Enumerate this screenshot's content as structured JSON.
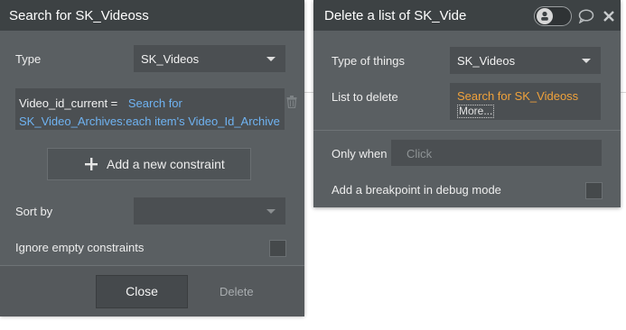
{
  "search_panel": {
    "title": "Search for SK_Videoss",
    "type_label": "Type",
    "type_value": "SK_Videos",
    "constraint": {
      "field": "Video_id_current =",
      "value_part1": "Search for",
      "value_part2": "SK_Video_Archives:each item's Video_Id_Archive"
    },
    "add_constraint_label": "Add a new constraint",
    "sort_by_label": "Sort by",
    "sort_by_value": "",
    "ignore_empty_label": "Ignore empty constraints",
    "ignore_empty_checked": false,
    "close_label": "Close",
    "delete_label": "Delete"
  },
  "action_panel": {
    "title": "Delete a list of SK_Videos",
    "type_of_things_label": "Type of things",
    "type_of_things_value": "SK_Videos",
    "list_to_delete_label": "List to delete",
    "list_to_delete_value": "Search for SK_Videoss",
    "more_label": "More...",
    "only_when_label": "Only when",
    "only_when_placeholder": "Click",
    "breakpoint_label": "Add a breakpoint in debug mode",
    "breakpoint_checked": false
  },
  "icons": {
    "plus": "plus-icon",
    "trash": "trash-icon",
    "toggle": "debug-toggle-icon",
    "comment": "comment-icon",
    "close": "close-icon"
  },
  "colors": {
    "panel_bg": "#5a5f62",
    "header_bg": "#3d4244",
    "field_bg": "#4b4f52",
    "link_blue": "#6fb3f2",
    "dynamic_orange": "#f0a23b"
  }
}
